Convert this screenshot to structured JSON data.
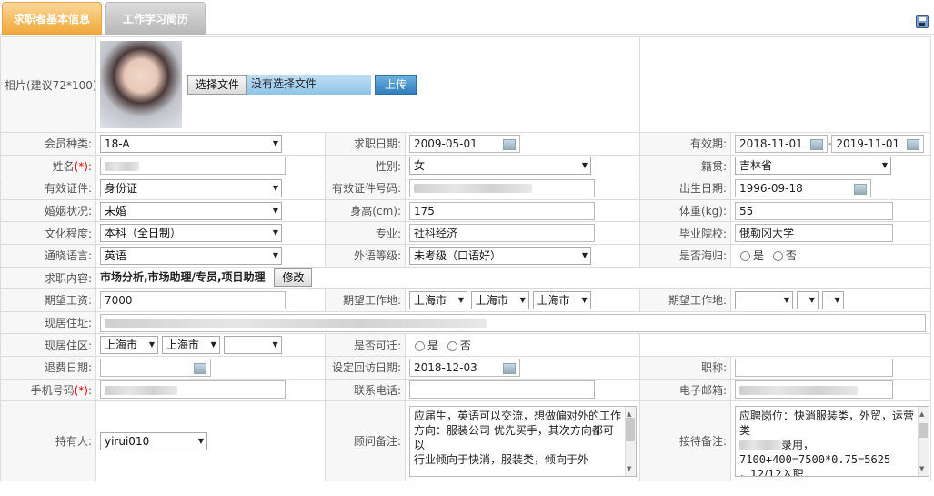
{
  "tabs": [
    {
      "label": "求职者基本信息"
    },
    {
      "label": "工作学习简历"
    }
  ],
  "photo": {
    "label": "相片(建议72*100):",
    "choose_file": "选择文件",
    "no_file": "没有选择文件",
    "upload": "上传"
  },
  "row1": {
    "member_label": "会员种类:",
    "member_value": "18-A",
    "date_label": "求职日期:",
    "date_value": "2009-05-01",
    "valid_label": "有效期:",
    "valid_from": "2018-11-01",
    "valid_sep": "-",
    "valid_to": "2019-11-01"
  },
  "row2": {
    "name_label": "姓名",
    "req": "(*)",
    "colon": ":",
    "gender_label": "性别:",
    "gender_value": "女",
    "origin_label": "籍贯:",
    "origin_value": "吉林省"
  },
  "row3": {
    "id_type_label": "有效证件:",
    "id_type_value": "身份证",
    "id_no_label": "有效证件号码:",
    "birth_label": "出生日期:",
    "birth_value": "1996-09-18"
  },
  "row4": {
    "marital_label": "婚姻状况:",
    "marital_value": "未婚",
    "height_label": "身高(cm):",
    "height_value": "175",
    "weight_label": "体重(kg):",
    "weight_value": "55"
  },
  "row5": {
    "edu_label": "文化程度:",
    "edu_value": "本科（全日制）",
    "major_label": "专业:",
    "major_value": "社科经济",
    "school_label": "毕业院校:",
    "school_value": "俄勒冈大学"
  },
  "row6": {
    "lang_label": "通晓语言:",
    "lang_value": "英语",
    "level_label": "外语等级:",
    "level_value": "未考级（口语好）",
    "overseas_label": "是否海归:",
    "yes": "是",
    "no": "否"
  },
  "row7": {
    "job_label": "求职内容:",
    "job_value": "市场分析,市场助理/专员,项目助理",
    "modify": "修改"
  },
  "row8": {
    "salary_label": "期望工资:",
    "salary_value": "7000",
    "loc_label": "期望工作地:",
    "loc1": "上海市",
    "loc2": "上海市",
    "loc3": "上海市",
    "loc2_label": "期望工作地:"
  },
  "row9": {
    "addr_label": "现居住址:"
  },
  "row10": {
    "area_label": "现居住区:",
    "area1": "上海市",
    "area2": "上海市",
    "relocate_label": "是否可迁:",
    "yes": "是",
    "no": "否"
  },
  "row11": {
    "refund_label": "退费日期:",
    "visit_label": "设定回访日期:",
    "visit_value": "2018-12-03",
    "title_label": "职称:"
  },
  "row12": {
    "mobile_label": "手机号码",
    "req": "(*)",
    "colon": ":",
    "phone_label": "联系电话:",
    "email_label": "电子邮箱:"
  },
  "row13": {
    "holder_label": "持有人:",
    "holder_value": "yirui010",
    "consult_label": "顾问备注:",
    "consult_note": "应届生，英语可以交流，想做偏对外的工作\n方向：服装公司 优先买手，其次方向都可以\n行业倾向于快消，服装类，倾向于外",
    "reception_label": "接待备注:",
    "reception_line1": "应聘岗位：快消服装类，外贸，运营类",
    "reception_line2": "录用，",
    "reception_line3": "7100+400=7500*0.75=5625",
    "reception_line4": "，12/12入职"
  }
}
